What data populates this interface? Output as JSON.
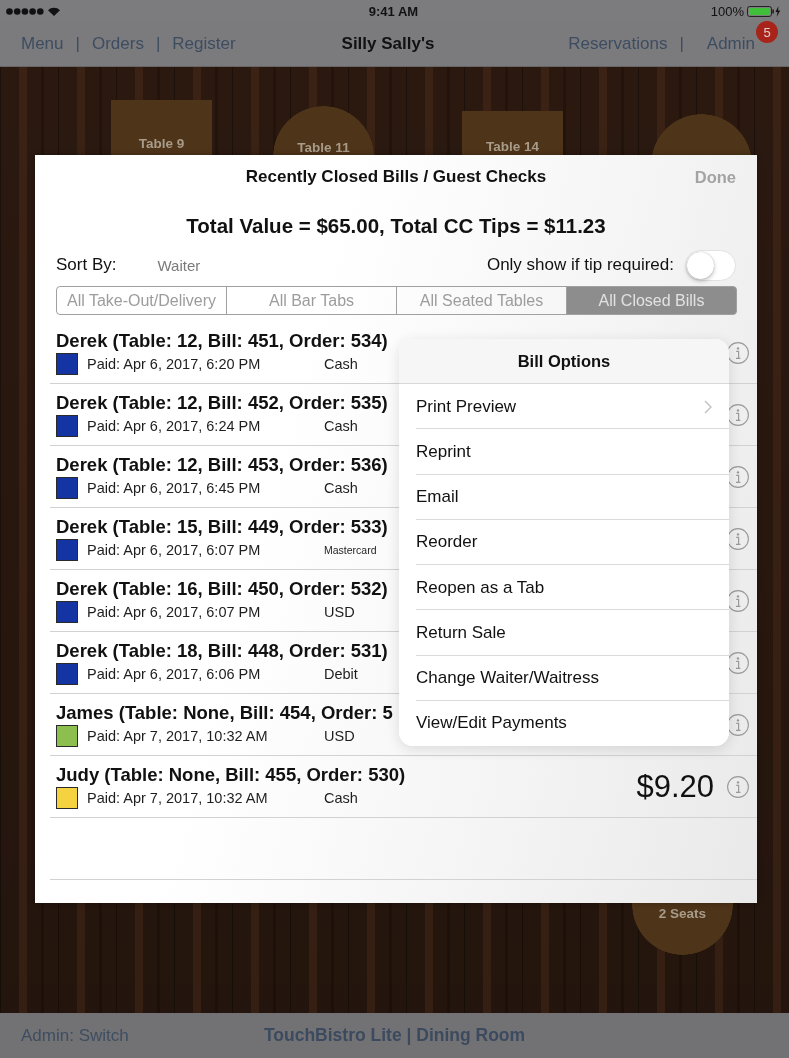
{
  "status_bar": {
    "time": "9:41 AM",
    "battery": "100%"
  },
  "nav_bar": {
    "left": [
      {
        "kind": "link",
        "label": "Menu"
      },
      {
        "kind": "divider",
        "label": "|"
      },
      {
        "kind": "link",
        "label": "Orders"
      },
      {
        "kind": "divider",
        "label": "|"
      },
      {
        "kind": "link",
        "label": "Register"
      }
    ],
    "title": "Silly Sally's",
    "right": [
      {
        "kind": "link",
        "label": "Reservations"
      },
      {
        "kind": "divider",
        "label": "|"
      },
      {
        "kind": "link",
        "label": "Admin",
        "badge": "5"
      }
    ]
  },
  "floor": {
    "tables": [
      {
        "kind": "square",
        "label": "Table 9"
      },
      {
        "kind": "round",
        "label": "Table 11"
      },
      {
        "kind": "square",
        "label": "Table 14"
      },
      {
        "kind": "round"
      },
      {
        "kind": "round",
        "label": "2 Seats"
      }
    ]
  },
  "closed_bills": {
    "title": "Recently Closed Bills / Guest Checks",
    "done": "Done",
    "totals": "Total Value = $65.00, Total CC Tips = $11.23",
    "sort_label": "Sort By:",
    "sort_value": "Waiter",
    "tip_filter": {
      "label": "Only show if tip required:",
      "on": false
    },
    "segments": [
      {
        "label": "All Take-Out/Delivery",
        "selected": false
      },
      {
        "label": "All Bar Tabs",
        "selected": false
      },
      {
        "label": "All Seated Tables",
        "selected": false
      },
      {
        "label": "All Closed Bills",
        "selected": true
      }
    ],
    "bills": [
      {
        "title": "Derek (Table: 12, Bill: 451, Order: 534)",
        "color": "#1434a4",
        "paid": "Paid: Apr 6, 2017, 6:20 PM",
        "method": "Cash"
      },
      {
        "title": "Derek (Table: 12, Bill: 452, Order: 535)",
        "color": "#1434a4",
        "paid": "Paid: Apr 6, 2017, 6:24 PM",
        "method": "Cash"
      },
      {
        "title": "Derek (Table: 12, Bill: 453, Order: 536)",
        "color": "#1434a4",
        "paid": "Paid: Apr 6, 2017, 6:45 PM",
        "method": "Cash"
      },
      {
        "title": "Derek (Table: 15, Bill: 449, Order: 533)",
        "color": "#1434a4",
        "paid": "Paid: Apr 6, 2017, 6:07 PM",
        "method": "Mastercard"
      },
      {
        "title": "Derek (Table: 16, Bill: 450, Order: 532)",
        "color": "#1434a4",
        "paid": "Paid: Apr 6, 2017, 6:07 PM",
        "method": "USD"
      },
      {
        "title": "Derek (Table: 18, Bill: 448, Order: 531)",
        "color": "#1434a4",
        "paid": "Paid: Apr 6, 2017, 6:06 PM",
        "method": "Debit"
      },
      {
        "title": "James (Table: None, Bill: 454, Order: 5",
        "color": "#8cbf4d",
        "paid": "Paid: Apr 7, 2017, 10:32 AM",
        "method": "USD"
      },
      {
        "title": "Judy (Table: None, Bill: 455, Order: 530)",
        "color": "#f5d23f",
        "paid": "Paid: Apr 7, 2017, 10:32 AM",
        "method": "Cash",
        "amount": "$9.20"
      }
    ]
  },
  "bill_options": {
    "title": "Bill Options",
    "items": [
      {
        "label": "Print Preview",
        "has_submenu": true
      },
      {
        "label": "Reprint",
        "has_submenu": false
      },
      {
        "label": "Email",
        "has_submenu": false
      },
      {
        "label": "Reorder",
        "has_submenu": false
      },
      {
        "label": "Reopen as a Tab",
        "has_submenu": false
      },
      {
        "label": "Return Sale",
        "has_submenu": false
      },
      {
        "label": "Change Waiter/Waitress",
        "has_submenu": false
      },
      {
        "label": "View/Edit Payments",
        "has_submenu": false
      }
    ]
  },
  "bottom_bar": {
    "switch": "Admin: Switch",
    "title": "TouchBistro Lite | Dining Room"
  }
}
